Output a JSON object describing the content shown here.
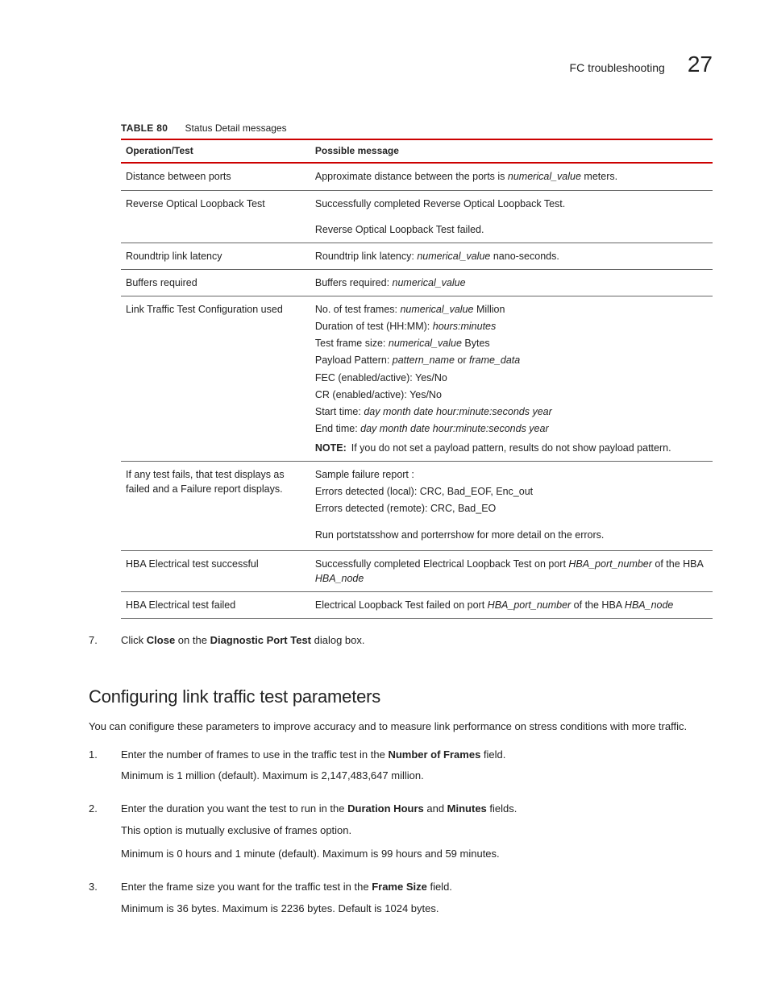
{
  "header": {
    "title": "FC troubleshooting",
    "page": "27"
  },
  "table": {
    "label": "TABLE 80",
    "caption": "Status Detail messages",
    "headers": [
      "Operation/Test",
      "Possible message"
    ],
    "rows": [
      {
        "op": "Distance between ports",
        "msg_pre": "Approximate distance between the ports is ",
        "msg_em": "numerical_value",
        "msg_post": " meters."
      },
      {
        "op": "Reverse Optical Loopback Test",
        "msg_plain": "Successfully completed Reverse Optical Loopback Test."
      },
      {
        "op": "",
        "msg_plain": "Reverse Optical Loopback Test failed.",
        "no_border": true
      },
      {
        "op": "Roundtrip link latency",
        "msg_pre": "Roundtrip link latency: ",
        "msg_em": "numerical_value",
        "msg_post": " nano-seconds."
      },
      {
        "op": "Buffers required",
        "msg_pre": "Buffers required: ",
        "msg_em": "numerical_value",
        "msg_post": ""
      }
    ],
    "cfg_row": {
      "op": "Link Traffic Test Configuration used",
      "lines": {
        "l1a": "No. of test frames: ",
        "l1b": "numerical_value",
        "l1c": " Million",
        "l2a": "Duration of test (HH:MM): ",
        "l2b": "hours:minutes",
        "l3a": "Test frame size: ",
        "l3b": "numerical_value",
        "l3c": " Bytes",
        "l4a": "Payload Pattern: ",
        "l4b": "pattern_name",
        "l4c": " or ",
        "l4d": "frame_data",
        "l5": "FEC (enabled/active): Yes/No",
        "l6": "CR (enabled/active): Yes/No",
        "l7a": "Start time: ",
        "l7b": "day month date hour:minute:seconds year",
        "l8a": "End time: ",
        "l8b": "day month date hour:minute:seconds year"
      },
      "note_label": "NOTE:",
      "note_text": "If you do not set a payload pattern, results do not show payload pattern."
    },
    "fail_row": {
      "op": "If any test fails, that test displays as failed and a Failure report displays.",
      "l1": "Sample failure report :",
      "l2": "Errors detected (local): CRC, Bad_EOF, Enc_out",
      "l3": "Errors detected (remote): CRC, Bad_EO",
      "l4": "Run portstatsshow and porterrshow for more detail on the errors."
    },
    "hba_ok": {
      "op": "HBA Electrical test successful",
      "a": "Successfully completed Electrical Loopback Test on port ",
      "b": "HBA_port_number",
      "c": " of the HBA ",
      "d": "HBA_node"
    },
    "hba_fail": {
      "op": "HBA Electrical test failed",
      "a": "Electrical Loopback Test failed on port ",
      "b": "HBA_port_number",
      "c": " of the HBA ",
      "d": "HBA_node"
    }
  },
  "step7": {
    "num": "7.",
    "a": "Click ",
    "b": "Close",
    "c": " on the ",
    "d": "Diagnostic Port Test",
    "e": " dialog box."
  },
  "section": {
    "title": "Configuring link traffic test parameters",
    "intro": "You can conifigure these parameters to improve accuracy and to measure link performance on stress conditions with more traffic.",
    "steps": [
      {
        "num": "1.",
        "p1a": "Enter the number of frames to use in the traffic test in the ",
        "p1b": "Number of Frames",
        "p1c": " field.",
        "p2": "Minimum is 1  million (default). Maximum is 2,147,483,647 million."
      },
      {
        "num": "2.",
        "p1a": "Enter the duration you want the test to run in the ",
        "p1b": "Duration Hours",
        "p1c": " and ",
        "p1d": "Minutes",
        "p1e": " fields.",
        "p2": "This option is mutually exclusive of frames option.",
        "p3": "Minimum is 0 hours and 1 minute (default). Maximum is 99 hours and 59 minutes."
      },
      {
        "num": "3.",
        "p1a": "Enter the frame size you want for the traffic test in the ",
        "p1b": "Frame Size",
        "p1c": " field.",
        "p2": "Minimum is 36 bytes. Maximum is 2236 bytes. Default is 1024 bytes."
      }
    ]
  }
}
